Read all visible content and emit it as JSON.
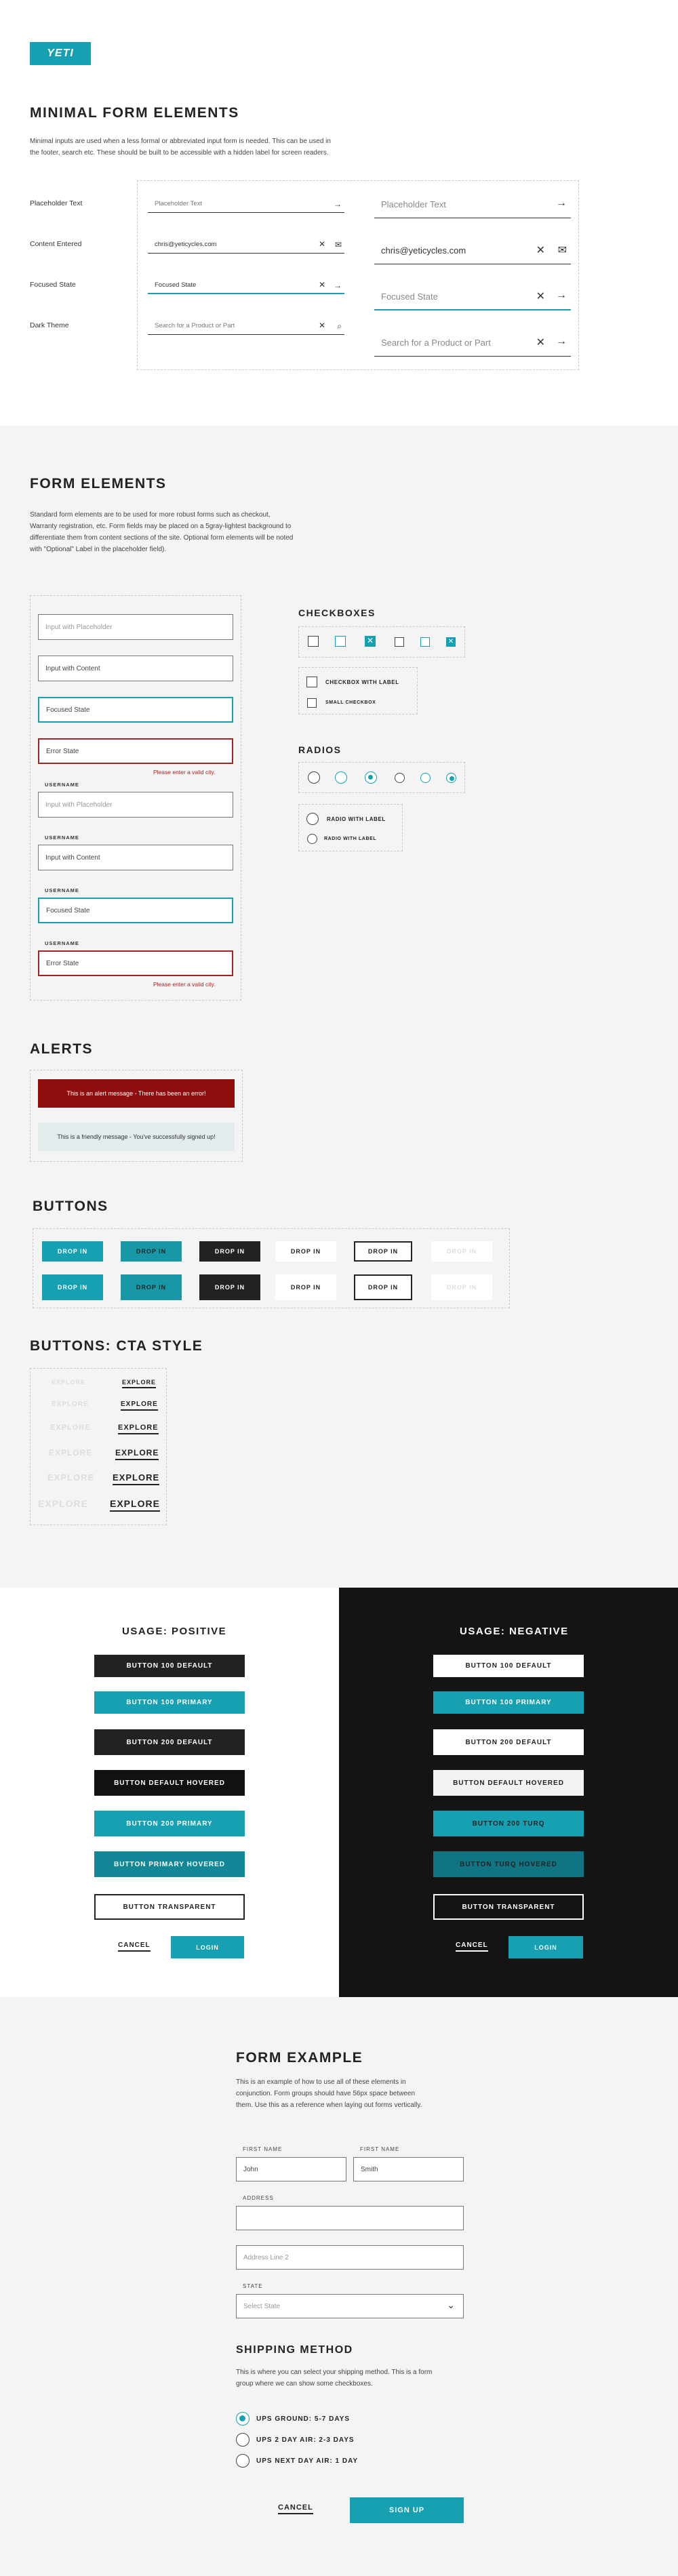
{
  "logo": "YETI",
  "minimal": {
    "title": "MINIMAL FORM ELEMENTS",
    "desc1": "Minimal inputs are used when a less formal or abbreviated input form is needed. This can be used in",
    "desc2": "the footer, search etc. These should be built to be accessible with a hidden label for screen readers.",
    "row_labels": [
      "Placeholder Text",
      "Content Entered",
      "Focused State",
      "Dark Theme"
    ],
    "small": [
      "Placeholder Text",
      "chris@yeticycles.com",
      "Focused State",
      "Search for a Product or Part"
    ],
    "large": [
      "Placeholder Text",
      "chris@yeticycles.com",
      "Focused State",
      "Search for a Product or Part"
    ]
  },
  "form": {
    "title": "FORM ELEMENTS",
    "desc": [
      "Standard form elements are to be used for more robust forms such as checkout,",
      "Warranty registration, etc. Form fields may be placed on a 5gray-lightest background to",
      "differentiate them from content sections of the site. Optional form elements will be noted",
      "with \"Optional\" Label in the placeholder field)."
    ],
    "inputs": [
      "Input with Placeholder",
      "Input with Content",
      "Focused State",
      "Error State",
      "Input with Placeholder",
      "Input with Content",
      "Focused State",
      "Error State"
    ],
    "error": "Please enter a valid city.",
    "username": "USERNAME",
    "checkboxes": "CHECKBOXES",
    "cb_label": "CHECKBOX WITH LABEL",
    "cb_small": "SMALL CHECKBOX",
    "radios": "RADIOS",
    "rd_label": "RADIO WITH LABEL",
    "rd_small": "RADIO WITH LABEL"
  },
  "alerts": {
    "title": "ALERTS",
    "error": "This is an alert message - There has been an error!",
    "friendly": "This is a friendly message - You've successfully signed up!"
  },
  "buttons": {
    "title": "BUTTONS",
    "label": "DROP IN"
  },
  "cta": {
    "title": "BUTTONS: CTA STYLE",
    "label": "EXPLORE"
  },
  "usage": {
    "pos_title": "USAGE: POSITIVE",
    "neg_title": "USAGE: NEGATIVE",
    "pos": [
      "BUTTON 100 DEFAULT",
      "BUTTON 100 PRIMARY",
      "BUTTON 200 DEFAULT",
      "BUTTON  DEFAULT HOVERED",
      "BUTTON 200 PRIMARY",
      "BUTTON PRIMARY HOVERED",
      "BUTTON TRANSPARENT"
    ],
    "neg": [
      "BUTTON 100 DEFAULT",
      "BUTTON 100 PRIMARY",
      "BUTTON 200 DEFAULT",
      "BUTTON DEFAULT HOVERED",
      "BUTTON 200 TURQ",
      "BUTTON TURQ HOVERED",
      "BUTTON TRANSPARENT"
    ],
    "cancel": "CANCEL",
    "login": "LOGIN"
  },
  "example": {
    "title": "FORM EXAMPLE",
    "desc": [
      "This is an example of how to use all of these elements in",
      "conjunction. Form groups should have 56px space between",
      "them. Use this as a reference when laying out forms vertically."
    ],
    "first_label": "FIRST NAME",
    "first1": "John",
    "first2": "Smith",
    "address_label": "ADDRESS",
    "address2": "Address Line 2",
    "state_label": "STATE",
    "state": "Select State",
    "ship_title": "SHIPPING METHOD",
    "ship_desc": [
      "This is where you can select your shipping method. This is a form",
      "group where we can show some checkboxes."
    ],
    "ship": [
      "UPS GROUND: 5-7 DAYS",
      "UPS 2 DAY AIR: 2-3 DAYS",
      "UPS NEXT DAY AIR: 1 DAY"
    ],
    "cancel": "CANCEL",
    "signup": "SIGN UP"
  },
  "colors": {
    "teal": "#16a0b1",
    "dark": "#222222",
    "error": "#a32424"
  }
}
